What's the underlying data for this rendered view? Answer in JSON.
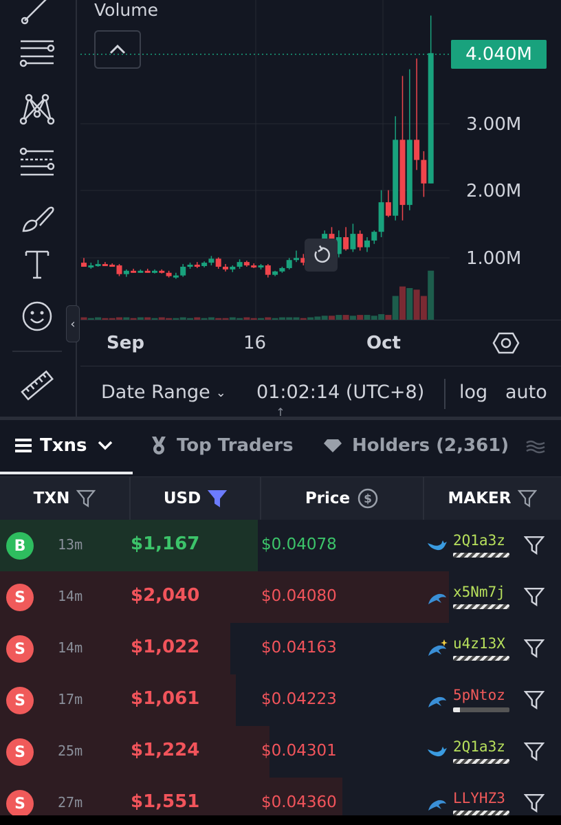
{
  "chart": {
    "volume_label": "Volume",
    "price_tag": "4.040M",
    "y_labels": [
      "3.00M",
      "2.00M",
      "1.00M"
    ],
    "x_labels": [
      "Sep",
      "16",
      "Oct"
    ],
    "up_color": "#19a27d",
    "down_color": "#f0454c"
  },
  "chart_data": {
    "type": "candlestick",
    "y_unit": "market cap (USD)",
    "yticks": [
      "1.00M",
      "2.00M",
      "3.00M"
    ],
    "ylim": [
      0,
      4400000
    ],
    "xticks": [
      "Sep",
      "16",
      "Oct"
    ],
    "current_value_label": "4.040M",
    "candles": [
      {
        "o": 0.92,
        "h": 0.99,
        "l": 0.86,
        "c": 0.86
      },
      {
        "o": 0.86,
        "h": 0.92,
        "l": 0.83,
        "c": 0.88
      },
      {
        "o": 0.88,
        "h": 0.96,
        "l": 0.86,
        "c": 0.9
      },
      {
        "o": 0.9,
        "h": 0.93,
        "l": 0.87,
        "c": 0.89
      },
      {
        "o": 0.89,
        "h": 0.91,
        "l": 0.86,
        "c": 0.88
      },
      {
        "o": 0.88,
        "h": 0.9,
        "l": 0.72,
        "c": 0.75
      },
      {
        "o": 0.75,
        "h": 0.82,
        "l": 0.71,
        "c": 0.8
      },
      {
        "o": 0.8,
        "h": 0.83,
        "l": 0.77,
        "c": 0.79
      },
      {
        "o": 0.79,
        "h": 0.82,
        "l": 0.77,
        "c": 0.8
      },
      {
        "o": 0.8,
        "h": 0.83,
        "l": 0.77,
        "c": 0.79
      },
      {
        "o": 0.79,
        "h": 0.82,
        "l": 0.76,
        "c": 0.8
      },
      {
        "o": 0.8,
        "h": 0.82,
        "l": 0.76,
        "c": 0.77
      },
      {
        "o": 0.77,
        "h": 0.8,
        "l": 0.7,
        "c": 0.72
      },
      {
        "o": 0.72,
        "h": 0.77,
        "l": 0.68,
        "c": 0.73
      },
      {
        "o": 0.73,
        "h": 0.9,
        "l": 0.71,
        "c": 0.86
      },
      {
        "o": 0.86,
        "h": 0.92,
        "l": 0.83,
        "c": 0.89
      },
      {
        "o": 0.89,
        "h": 0.93,
        "l": 0.84,
        "c": 0.87
      },
      {
        "o": 0.87,
        "h": 0.94,
        "l": 0.85,
        "c": 0.92
      },
      {
        "o": 0.92,
        "h": 1.02,
        "l": 0.88,
        "c": 0.98
      },
      {
        "o": 0.98,
        "h": 1.0,
        "l": 0.83,
        "c": 0.86
      },
      {
        "o": 0.86,
        "h": 0.9,
        "l": 0.79,
        "c": 0.82
      },
      {
        "o": 0.82,
        "h": 0.88,
        "l": 0.78,
        "c": 0.86
      },
      {
        "o": 0.86,
        "h": 0.97,
        "l": 0.83,
        "c": 0.93
      },
      {
        "o": 0.93,
        "h": 0.95,
        "l": 0.86,
        "c": 0.88
      },
      {
        "o": 0.88,
        "h": 0.91,
        "l": 0.84,
        "c": 0.85
      },
      {
        "o": 0.85,
        "h": 0.9,
        "l": 0.82,
        "c": 0.88
      },
      {
        "o": 0.88,
        "h": 0.9,
        "l": 0.7,
        "c": 0.74
      },
      {
        "o": 0.74,
        "h": 0.8,
        "l": 0.72,
        "c": 0.79
      },
      {
        "o": 0.79,
        "h": 0.86,
        "l": 0.77,
        "c": 0.84
      },
      {
        "o": 0.84,
        "h": 0.99,
        "l": 0.82,
        "c": 0.96
      },
      {
        "o": 0.96,
        "h": 1.1,
        "l": 0.93,
        "c": 0.99
      },
      {
        "o": 0.99,
        "h": 1.05,
        "l": 0.88,
        "c": 0.92
      },
      {
        "o": 0.92,
        "h": 0.98,
        "l": 0.88,
        "c": 0.95
      },
      {
        "o": 0.95,
        "h": 1.05,
        "l": 0.92,
        "c": 1.0
      },
      {
        "o": 1.0,
        "h": 1.4,
        "l": 0.95,
        "c": 1.35
      },
      {
        "o": 1.35,
        "h": 1.45,
        "l": 1.0,
        "c": 1.05
      },
      {
        "o": 1.05,
        "h": 1.4,
        "l": 1.0,
        "c": 1.3
      },
      {
        "o": 1.3,
        "h": 1.45,
        "l": 1.1,
        "c": 1.12
      },
      {
        "o": 1.12,
        "h": 1.5,
        "l": 1.08,
        "c": 1.35
      },
      {
        "o": 1.35,
        "h": 1.4,
        "l": 1.1,
        "c": 1.15
      },
      {
        "o": 1.15,
        "h": 1.3,
        "l": 1.08,
        "c": 1.25
      },
      {
        "o": 1.25,
        "h": 1.4,
        "l": 1.2,
        "c": 1.38
      },
      {
        "o": 1.38,
        "h": 2.0,
        "l": 1.3,
        "c": 1.82
      },
      {
        "o": 1.82,
        "h": 2.0,
        "l": 1.6,
        "c": 1.62
      },
      {
        "o": 1.62,
        "h": 3.1,
        "l": 1.55,
        "c": 2.75
      },
      {
        "o": 2.75,
        "h": 3.7,
        "l": 1.55,
        "c": 1.78
      },
      {
        "o": 1.78,
        "h": 3.8,
        "l": 1.7,
        "c": 2.75
      },
      {
        "o": 2.75,
        "h": 3.96,
        "l": 2.3,
        "c": 2.45
      },
      {
        "o": 2.45,
        "h": 2.58,
        "l": 1.9,
        "c": 2.1
      },
      {
        "o": 2.1,
        "h": 4.6,
        "l": 2.1,
        "c": 4.04
      }
    ],
    "volumes": [
      0.03,
      0.02,
      0.03,
      0.02,
      0.02,
      0.03,
      0.03,
      0.02,
      0.03,
      0.03,
      0.02,
      0.03,
      0.02,
      0.02,
      0.03,
      0.02,
      0.03,
      0.02,
      0.03,
      0.02,
      0.02,
      0.03,
      0.02,
      0.03,
      0.02,
      0.02,
      0.03,
      0.02,
      0.03,
      0.03,
      0.03,
      0.02,
      0.03,
      0.04,
      0.05,
      0.05,
      0.06,
      0.06,
      0.05,
      0.06,
      0.06,
      0.05,
      0.07,
      0.06,
      0.3,
      0.42,
      0.4,
      0.38,
      0.3,
      0.62
    ]
  },
  "bottom_bar": {
    "date_range": "Date Range",
    "time": "01:02:14 (UTC+8)",
    "log": "log",
    "auto": "auto"
  },
  "tabs": {
    "txns": "Txns",
    "top_traders": "Top Traders",
    "holders": "Holders (2,361)"
  },
  "table": {
    "headers": {
      "txn": "TXN",
      "usd": "USD",
      "price": "Price",
      "maker": "MAKER"
    },
    "rows": [
      {
        "type": "B",
        "age": "13m",
        "usd": "$1,167",
        "price": "$0.04078",
        "maker": "2Q1a3z",
        "icon": "whale-icon",
        "fill": 0.46
      },
      {
        "type": "S",
        "age": "14m",
        "usd": "$2,040",
        "price": "$0.04080",
        "maker": "x5Nm7j",
        "icon": "dolphin-icon",
        "fill": 0.8
      },
      {
        "type": "S",
        "age": "14m",
        "usd": "$1,022",
        "price": "$0.04163",
        "maker": "u4z13X",
        "icon": "dolphin-sparkle-icon",
        "fill": 0.41
      },
      {
        "type": "S",
        "age": "17m",
        "usd": "$1,061",
        "price": "$0.04223",
        "maker": "5pNtoz",
        "icon": "dolphin-icon",
        "fill": 0.42
      },
      {
        "type": "S",
        "age": "25m",
        "usd": "$1,224",
        "price": "$0.04301",
        "maker": "2Q1a3z",
        "icon": "whale-icon",
        "fill": 0.48
      },
      {
        "type": "S",
        "age": "27m",
        "usd": "$1,551",
        "price": "$0.04360",
        "maker": "LLYHZ3",
        "icon": "dolphin-icon",
        "fill": 0.61
      }
    ]
  },
  "colors": {
    "buy": "#2ebd5f",
    "sell": "#f05a5a",
    "buy_text": "#3cc46a",
    "sell_text": "#f2545b",
    "maker_text": "#b7e05c",
    "maker_text_red": "#f25a5a",
    "accent_filter": "#6c7cff"
  }
}
